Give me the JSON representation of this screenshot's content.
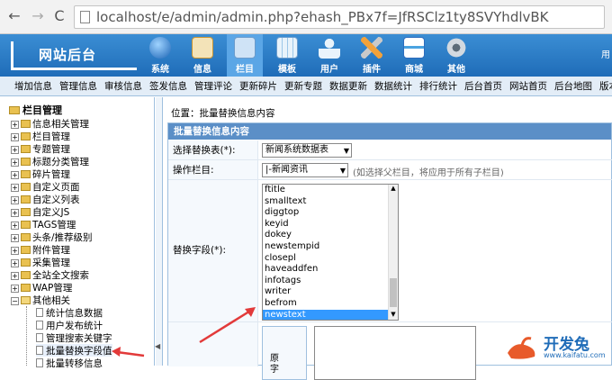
{
  "browser": {
    "url": "localhost/e/admin/admin.php?ehash_PBx7f=JfRSClz1ty8SVYhdlvBK",
    "back": "←",
    "forward": "→",
    "reload": "C"
  },
  "header": {
    "logo": "网站后台",
    "nav": [
      {
        "label": "系统",
        "icon": "globe-icon",
        "color": "#2b7fd1"
      },
      {
        "label": "信息",
        "icon": "notepad-icon",
        "color": "#d9a04a"
      },
      {
        "label": "栏目",
        "icon": "folder-icon",
        "color": "#7fb2e3"
      },
      {
        "label": "模板",
        "icon": "table-icon",
        "color": "#8fc3e8"
      },
      {
        "label": "用户",
        "icon": "user-icon",
        "color": "#2e6dbd"
      },
      {
        "label": "插件",
        "icon": "tools-icon",
        "color": "#e07b22"
      },
      {
        "label": "商城",
        "icon": "card-icon",
        "color": "#4aa3e0"
      },
      {
        "label": "其他",
        "icon": "gear-icon",
        "color": "#bfc8d2"
      }
    ],
    "right_text": "用"
  },
  "menubar": [
    "增加信息",
    "管理信息",
    "审核信息",
    "签发信息",
    "管理评论",
    "更新碎片",
    "更新专题",
    "数据更新",
    "数据统计",
    "排行统计",
    "后台首页",
    "网站首页",
    "后台地图",
    "版本更新"
  ],
  "sidebar": {
    "root": "栏目管理",
    "items": [
      "信息相关管理",
      "栏目管理",
      "专题管理",
      "标题分类管理",
      "碎片管理",
      "自定义页面",
      "自定义列表",
      "自定义JS",
      "TAGS管理",
      "头条/推荐级别",
      "附件管理",
      "采集管理",
      "全站全文搜索",
      "WAP管理",
      "其他相关"
    ],
    "sub_items": [
      "统计信息数据",
      "用户发布统计",
      "管理搜索关键字",
      "批量替换字段值",
      "批量转移信息"
    ]
  },
  "main": {
    "position_label": "位置：",
    "position_link": "批量替换信息内容",
    "panel_title": "批量替换信息内容",
    "form": {
      "table_label": "选择替换表(*):",
      "table_value": "新闻系统数据表",
      "column_label": "操作栏目:",
      "column_value": "|-新闻资讯",
      "column_hint": "(如选择父栏目，将应用于所有子栏目)",
      "field_label": "替换字段(*):",
      "field_options": [
        "ftitle",
        "smalltext",
        "diggtop",
        "keyid",
        "dokey",
        "newstempid",
        "closepl",
        "haveaddfen",
        "infotags",
        "writer",
        "befrom",
        "newstext"
      ],
      "field_selected": "newstext",
      "orig_label": "原字"
    }
  },
  "watermark": {
    "brand": "开发兔",
    "url": "www.kaifatu.com"
  },
  "colors": {
    "header": "#1f6cb8",
    "panel_head": "#5b8fc7",
    "arrow": "#e23a3a",
    "selected": "#3399ff"
  }
}
